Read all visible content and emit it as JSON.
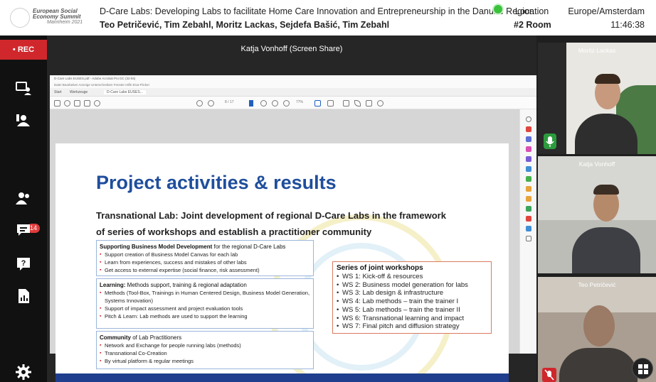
{
  "header": {
    "logo_text": "European Social Economy Summit",
    "logo_sub": "Mannheim 2021",
    "session_title": "D-Care Labs: Developing Labs to facilitate Home Care Innovation and Entrepreneurship in the Danube Region",
    "authors": "Teo Petričević, Tim Zebahl, Moritz Lackas, Sejdefa Bašić, Tim Zebahl",
    "location_label": "Location",
    "room": "#2 Room",
    "timezone": "Europe/Amsterdam",
    "time": "11:46:38",
    "live_color": "#3cc23c"
  },
  "sidebar": {
    "rec_label": "• REC",
    "attendees_badge": "14",
    "icons": [
      "presentation-icon",
      "participants-icon",
      "attendees-icon",
      "chat-icon",
      "qa-icon",
      "poll-icon",
      "settings-icon"
    ]
  },
  "stage": {
    "presenter_label": "Katja Vonhoff (Screen Share)"
  },
  "acrobat": {
    "title_bar": "D-Care Labs EUSES.pdf - Adobe Acrobat Pro DC (32-bit)",
    "menu": "Datei  Bearbeiten  Anzeige  Unterschreiben  Fenster  Hilfe  Eiva-Flicker",
    "tabs": [
      "Start",
      "Werkzeuge",
      "D-Care Labs EUSES..."
    ],
    "page_indicator": "8 / 17",
    "zoom": "77%"
  },
  "slide": {
    "title": "Project activities & results",
    "subtitle_1": "Transnational Lab: Joint development of regional D-Care Labs in the framework",
    "subtitle_2": "of series of workshops and establish a practitioner community",
    "box1": {
      "head_bold": "Supporting Business Model Development",
      "head_rest": " for the regional D-Care Labs",
      "items": [
        "Support creation of Business Model Canvas for each lab",
        "Learn from experiences, success and mistakes of other labs",
        "Get access to external expertise (social finance, risk assessment)"
      ]
    },
    "box2": {
      "head_bold": "Learning:",
      "head_rest": " Methods support, training & regional adaptation",
      "items": [
        "Methods (Tool-Box, Trainings in Human Centered Design, Business Model Generation, Systems Innovation)",
        "Support of impact assessment and project evaluation tools",
        "Pitch & Learn: Lab methods are used to support the learning"
      ]
    },
    "box3": {
      "head_bold": "Community",
      "head_rest": " of Lab Practitioners",
      "items": [
        "Network and Exchange for people running labs (methods)",
        "Transnational Co-Creation",
        "By virtual platform & regular meetings"
      ]
    },
    "workshops": {
      "head": "Series of joint workshops",
      "items": [
        "WS 1: Kick-off & resources",
        "WS 2: Business model generation for labs",
        "WS 3: Lab design & infrastructure",
        "WS 4: Lab methods – train the trainer I",
        "WS 5: Lab methods – train the trainer II",
        "WS 6: Transnational learning and impact",
        "WS 7: Final pitch and diffusion strategy"
      ]
    }
  },
  "participants": [
    {
      "name": "Moritz Lackas",
      "mic": "on"
    },
    {
      "name": "Katja Vonhoff",
      "mic": "none"
    },
    {
      "name": "Teo Petričević",
      "mic": "off"
    }
  ]
}
